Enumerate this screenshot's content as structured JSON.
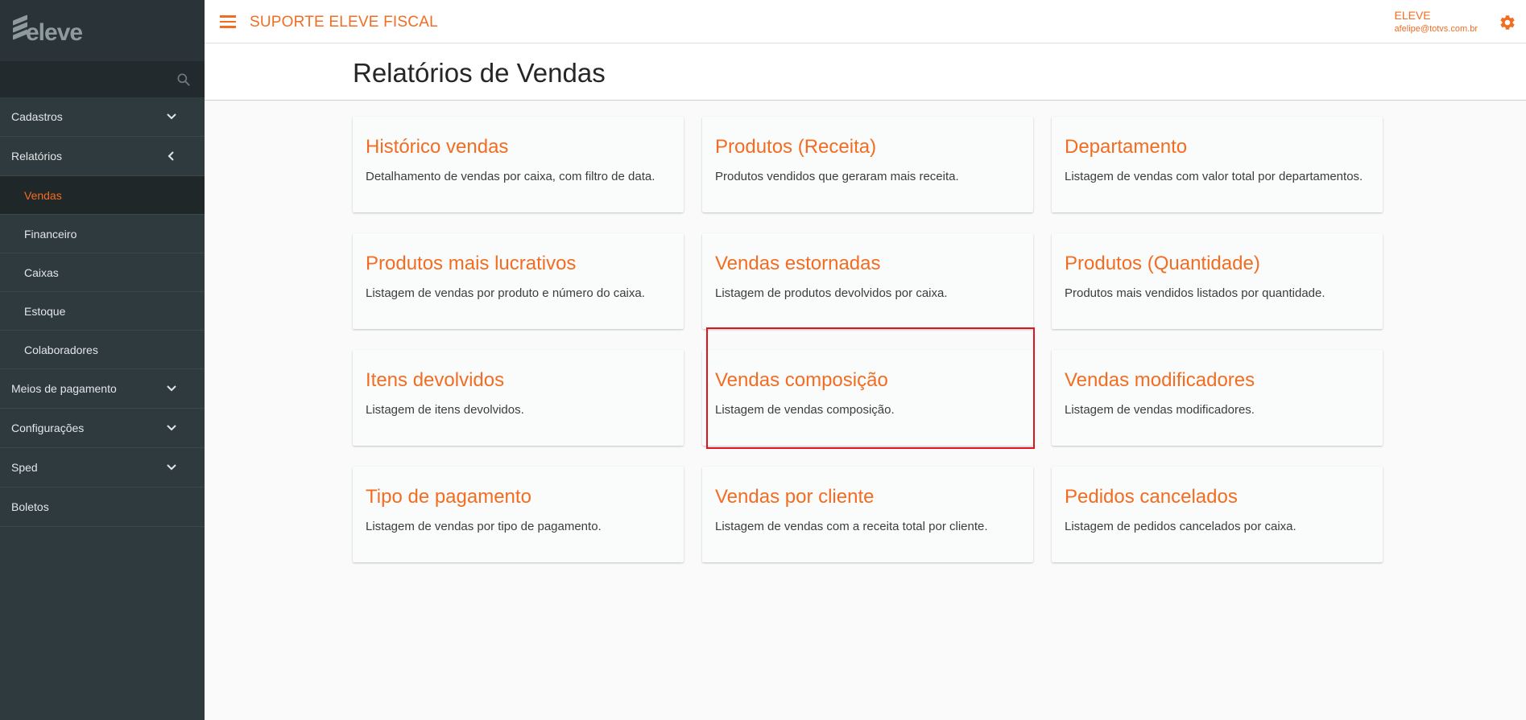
{
  "brand": {
    "logo_text": "eleve",
    "app_title": "SUPORTE ELEVE FISCAL"
  },
  "user": {
    "name": "ELEVE",
    "email": "afelipe@totvs.com.br"
  },
  "sidebar": {
    "search_placeholder": "",
    "items": [
      {
        "label": "Cadastros",
        "chevron": "down"
      },
      {
        "label": "Relatórios",
        "chevron": "left"
      },
      {
        "label": "Vendas",
        "sub": true,
        "active": true
      },
      {
        "label": "Financeiro",
        "sub": true
      },
      {
        "label": "Caixas",
        "sub": true
      },
      {
        "label": "Estoque",
        "sub": true
      },
      {
        "label": "Colaboradores",
        "sub": true
      },
      {
        "label": "Meios de pagamento",
        "chevron": "down"
      },
      {
        "label": "Configurações",
        "chevron": "down"
      },
      {
        "label": "Sped",
        "chevron": "down"
      },
      {
        "label": "Boletos"
      }
    ]
  },
  "page": {
    "title": "Relatórios de Vendas"
  },
  "cards": [
    {
      "title": "Histórico vendas",
      "desc": "Detalhamento de vendas por caixa, com filtro de data."
    },
    {
      "title": "Produtos (Receita)",
      "desc": "Produtos vendidos que geraram mais receita."
    },
    {
      "title": "Departamento",
      "desc": "Listagem de vendas com valor total por departamentos."
    },
    {
      "title": "Produtos mais lucrativos",
      "desc": "Listagem de vendas por produto e número do caixa."
    },
    {
      "title": "Vendas estornadas",
      "desc": "Listagem de produtos devolvidos por caixa."
    },
    {
      "title": "Produtos (Quantidade)",
      "desc": "Produtos mais vendidos listados por quantidade."
    },
    {
      "title": "Itens devolvidos",
      "desc": "Listagem de itens devolvidos."
    },
    {
      "title": "Vendas composição",
      "desc": "Listagem de vendas composição."
    },
    {
      "title": "Vendas modificadores",
      "desc": "Listagem de vendas modificadores."
    },
    {
      "title": "Tipo de pagamento",
      "desc": "Listagem de vendas por tipo de pagamento."
    },
    {
      "title": "Vendas por cliente",
      "desc": "Listagem de vendas com a receita total por cliente."
    },
    {
      "title": "Pedidos cancelados",
      "desc": "Listagem de pedidos cancelados por caixa."
    }
  ],
  "colors": {
    "accent": "#f26d21",
    "sidebar_bg": "#2e3a3e",
    "highlight": "#e2131d"
  }
}
